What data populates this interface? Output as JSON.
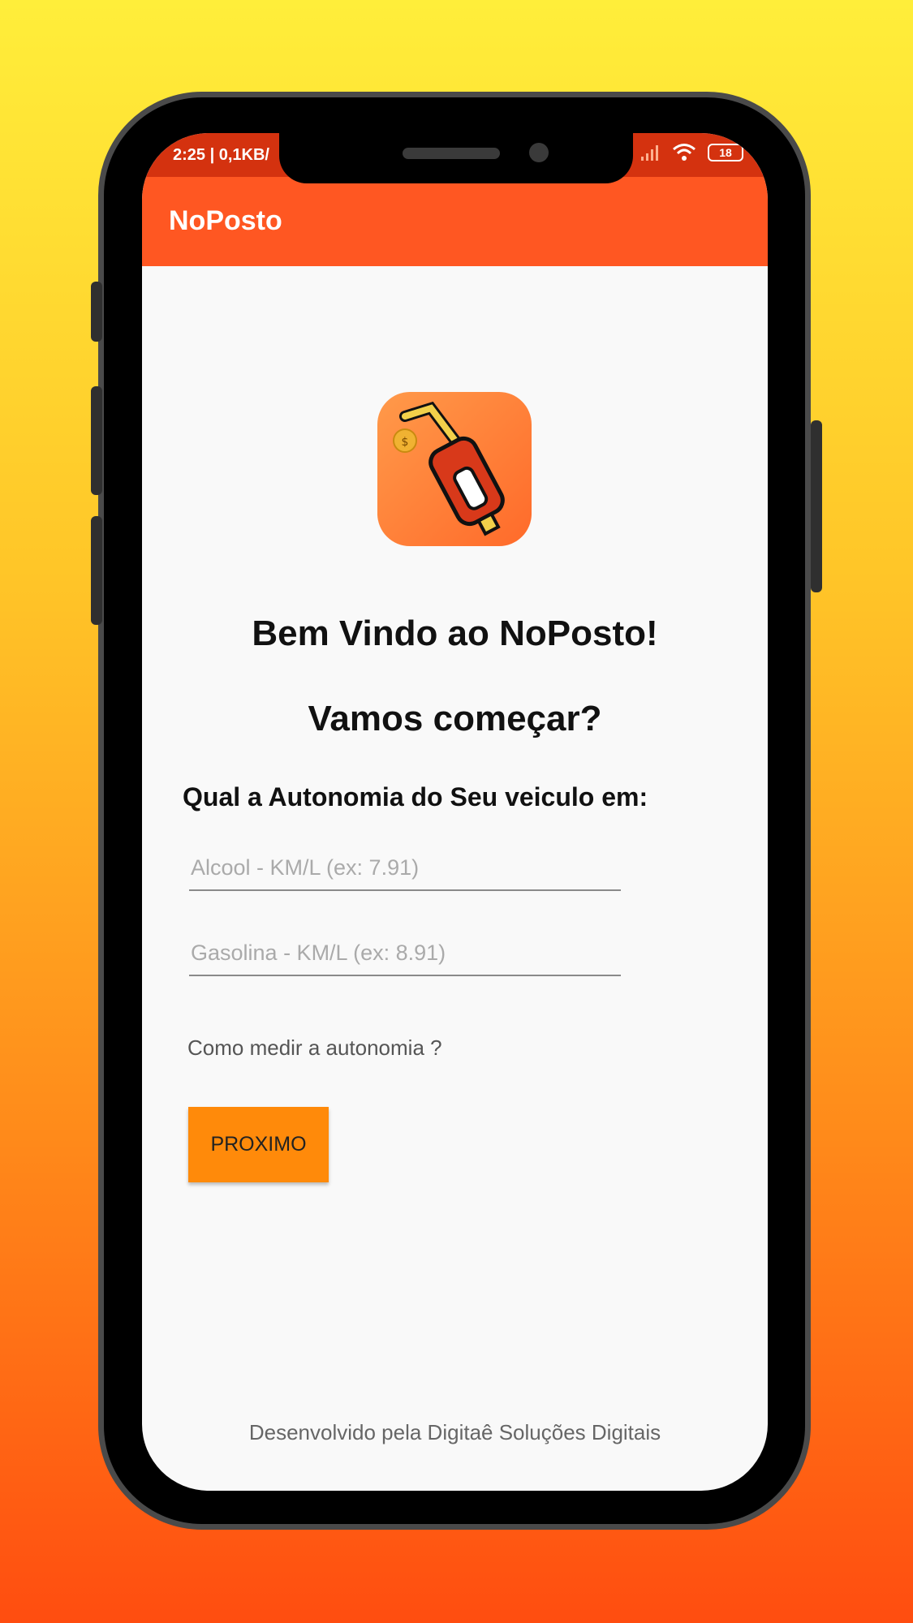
{
  "status_bar": {
    "time": "2:25 | 0,1KB/",
    "battery": "18"
  },
  "app_bar": {
    "title": "NoPosto"
  },
  "welcome": {
    "title": "Bem Vindo ao NoPosto!",
    "subtitle": "Vamos começar?"
  },
  "form": {
    "question": "Qual a Autonomia do Seu veiculo em:",
    "alcool": {
      "placeholder": "Alcool - KM/L (ex: 7.91)",
      "value": ""
    },
    "gasolina": {
      "placeholder": "Gasolina - KM/L (ex: 8.91)",
      "value": ""
    },
    "help_link": "Como medir a autonomia ?",
    "next_label": "PROXIMO"
  },
  "footer": {
    "text": "Desenvolvido pela Digitaê Soluções Digitais"
  },
  "colors": {
    "app_bar": "#ff5722",
    "button": "#ff8a0a",
    "status_bar": "#d4320f"
  },
  "icons": {
    "logo": "fuel-pump-icon",
    "signal": "signal-icon",
    "wifi": "wifi-icon",
    "battery": "battery-icon"
  }
}
